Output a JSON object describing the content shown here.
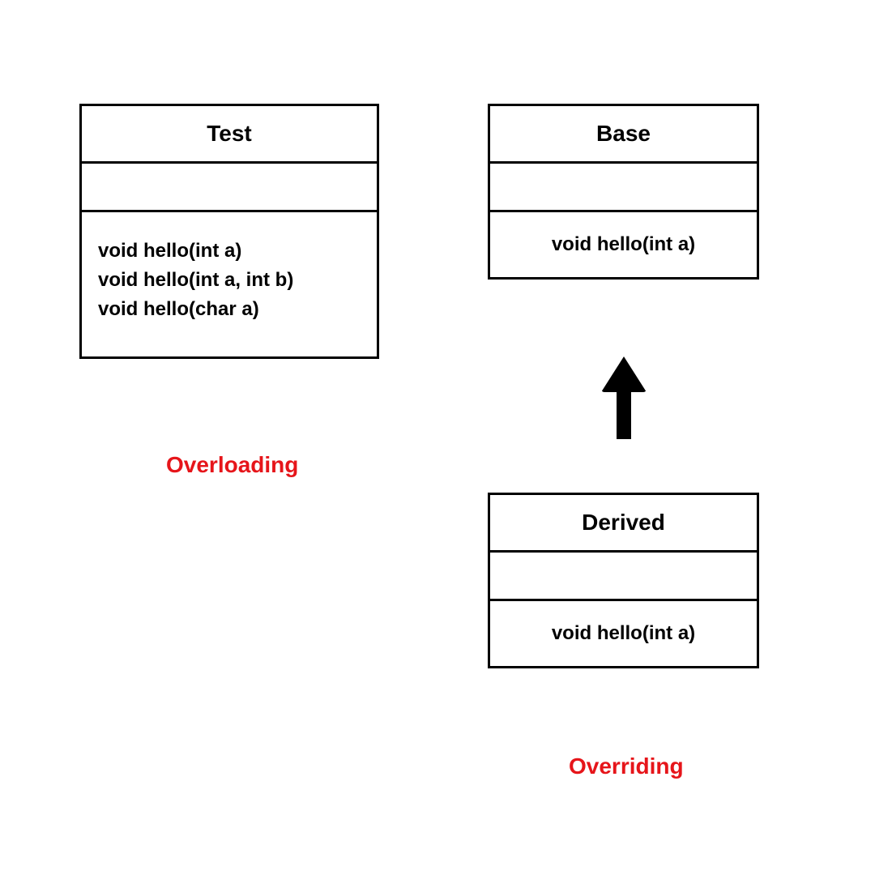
{
  "left": {
    "class_name": "Test",
    "methods": {
      "m1": "void hello(int a)",
      "m2": "void hello(int a, int b)",
      "m3": "void hello(char a)"
    },
    "caption": "Overloading"
  },
  "right": {
    "base": {
      "class_name": "Base",
      "method": "void hello(int a)"
    },
    "derived": {
      "class_name": "Derived",
      "method": "void hello(int a)"
    },
    "caption": "Overriding"
  }
}
